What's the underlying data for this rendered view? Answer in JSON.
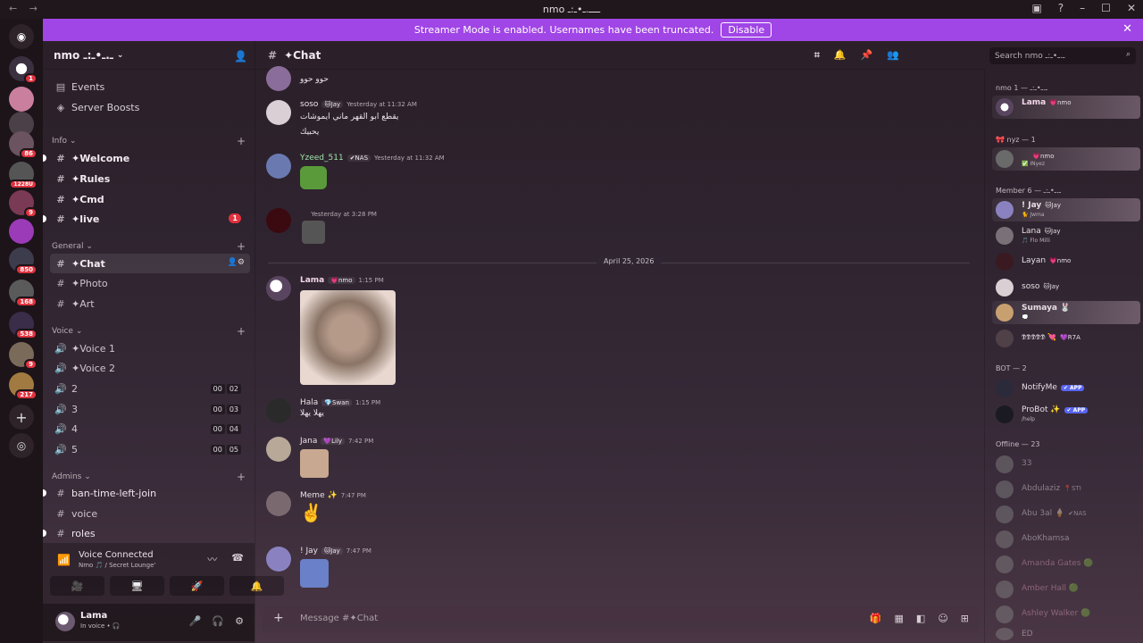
{
  "window": {
    "title": "nmo ــــ.ـ•ـ:ـ",
    "nav_back": "←",
    "nav_fwd": "→"
  },
  "banner": {
    "text": "Streamer Mode is enabled. Usernames have been truncated.",
    "button": "Disable"
  },
  "guild_badges": [
    "1",
    "86",
    "1228U",
    "9",
    "850",
    "168",
    "538",
    "9",
    "217"
  ],
  "server": {
    "name": "nmo ـ.ـ•ـ:ـ"
  },
  "sidebar": {
    "events": "Events",
    "boosts": "Server Boosts",
    "cat_info": "Info",
    "cat_general": "General",
    "cat_voice": "Voice",
    "cat_admins": "Admins",
    "channels": {
      "welcome": "✦Welcome",
      "rules": "✦Rules",
      "cmd": "✦Cmd",
      "live": "✦live",
      "chat": "✦Chat",
      "photo": "✦Photo",
      "art": "✦Art",
      "voice1": "✦Voice 1",
      "voice2": "✦Voice 2",
      "v2": "2",
      "v3": "3",
      "v4": "4",
      "v5": "5",
      "ban": "ban-time-left-join",
      "voice": "voice",
      "roles": "roles"
    },
    "live_mentions": "1",
    "voice_counts": {
      "v2": [
        "00",
        "02"
      ],
      "v3": [
        "00",
        "03"
      ],
      "v4": [
        "00",
        "04"
      ],
      "v5": [
        "00",
        "05"
      ]
    }
  },
  "voice_panel": {
    "title": "Voice Connected",
    "sub": "Nmo 🎵 / Secret Lounge'"
  },
  "user": {
    "name": "Lama",
    "status": "In voice • 🎧"
  },
  "chat": {
    "channel": "✦Chat",
    "date_divider": "April 25, 2026",
    "placeholder": "Message #✦Chat",
    "messages": [
      {
        "text": "حوو حوو"
      },
      {
        "name": "soso",
        "tag": "🐱Jay",
        "time": "Yesterday at 11:32 AM",
        "text": "يقطع ابو القهر ماني ايموشات",
        "text2": "يحبيك"
      },
      {
        "name": "Yzeed_511",
        "tag": "✔NAS",
        "time": "Yesterday at 11:32 AM"
      },
      {
        "name": "ㅤ",
        "time": "Yesterday at 3:28 PM"
      },
      {
        "name": "Lama",
        "tag": "💗nmo",
        "time": "1:15 PM"
      },
      {
        "name": "Hala",
        "tag": "💎Swan",
        "time": "1:15 PM",
        "text": "يهلا يهلا"
      },
      {
        "name": "Jana",
        "tag": "💜Lily",
        "time": "7:42 PM"
      },
      {
        "name": "Meme ✨",
        "time": "7:47 PM",
        "text": "✌️"
      },
      {
        "name": "! Jay",
        "tag": "🐱Jay",
        "time": "7:47 PM"
      }
    ]
  },
  "search": {
    "placeholder": "Search nmo ـ.ـ•ـ:ـ"
  },
  "members": {
    "sections": {
      "nmo": "nmo ـ.ـ•ـ:ـ — 1",
      "nyz": "🎀 nyz — 1",
      "member": "Member ـ.ـ•ـ:ـ — 6",
      "bot": "BOT — 2",
      "offline": "Offline — 23"
    },
    "online": [
      {
        "name": "Lama",
        "tag": "💗nmo"
      },
      {
        "name": "ㅤ",
        "tag": "💗nmo",
        "sub": "✅ INyez"
      },
      {
        "name": "! Jay",
        "tag": "🐱Jay",
        "sub": "🐈 Jwma"
      },
      {
        "name": "Lana",
        "tag": "🐱Jay",
        "sub": "🎵 Flo Milli"
      },
      {
        "name": "Layan",
        "tag": "💗nmo"
      },
      {
        "name": "soso",
        "tag": "🐱Jay"
      },
      {
        "name": "Sumaya 🐰",
        "sub": "💭"
      },
      {
        "name": "𝕯𝕯𝕯𝕯𝕯 💘",
        "tag": "💜R7A"
      }
    ],
    "bots": [
      {
        "name": "NotifyMe",
        "badge": "✔ APP"
      },
      {
        "name": "ProBot ✨",
        "badge": "✔ APP",
        "sub": "/help"
      }
    ],
    "offline": [
      {
        "name": "33"
      },
      {
        "name": "Abdulaziz",
        "tag": "📍STI"
      },
      {
        "name": "Abu 3al 🍦",
        "tag": "✔NAS"
      },
      {
        "name": "AboKhamsa"
      },
      {
        "name": "Amanda Gates 🟢"
      },
      {
        "name": "Amber Hall 🟢"
      },
      {
        "name": "Ashley Walker 🟢"
      },
      {
        "name": "ED"
      }
    ]
  }
}
